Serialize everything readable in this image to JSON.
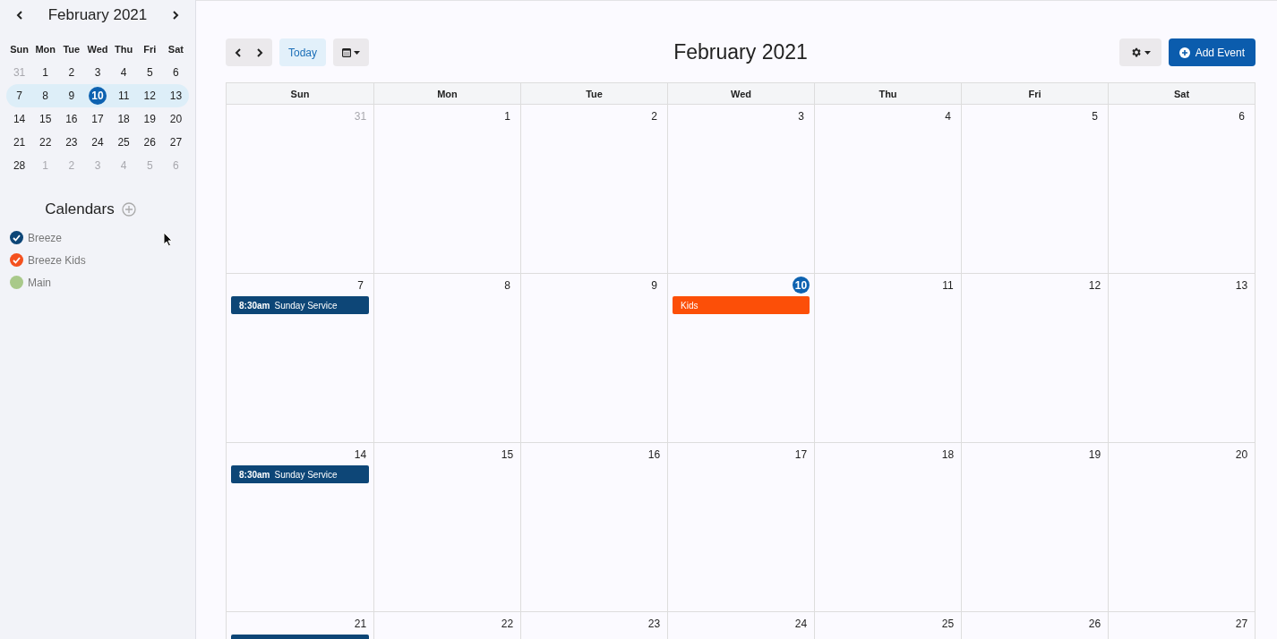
{
  "mini_calendar": {
    "title": "February 2021",
    "weekdays": [
      "Sun",
      "Mon",
      "Tue",
      "Wed",
      "Thu",
      "Fri",
      "Sat"
    ],
    "weeks": [
      {
        "selected": false,
        "days": [
          {
            "label": "31",
            "muted": true,
            "selected": false
          },
          {
            "label": "1",
            "muted": false,
            "selected": false
          },
          {
            "label": "2",
            "muted": false,
            "selected": false
          },
          {
            "label": "3",
            "muted": false,
            "selected": false
          },
          {
            "label": "4",
            "muted": false,
            "selected": false
          },
          {
            "label": "5",
            "muted": false,
            "selected": false
          },
          {
            "label": "6",
            "muted": false,
            "selected": false
          }
        ]
      },
      {
        "selected": true,
        "days": [
          {
            "label": "7",
            "muted": false,
            "selected": false
          },
          {
            "label": "8",
            "muted": false,
            "selected": false
          },
          {
            "label": "9",
            "muted": false,
            "selected": false
          },
          {
            "label": "10",
            "muted": false,
            "selected": true
          },
          {
            "label": "11",
            "muted": false,
            "selected": false
          },
          {
            "label": "12",
            "muted": false,
            "selected": false
          },
          {
            "label": "13",
            "muted": false,
            "selected": false
          }
        ]
      },
      {
        "selected": false,
        "days": [
          {
            "label": "14",
            "muted": false,
            "selected": false
          },
          {
            "label": "15",
            "muted": false,
            "selected": false
          },
          {
            "label": "16",
            "muted": false,
            "selected": false
          },
          {
            "label": "17",
            "muted": false,
            "selected": false
          },
          {
            "label": "18",
            "muted": false,
            "selected": false
          },
          {
            "label": "19",
            "muted": false,
            "selected": false
          },
          {
            "label": "20",
            "muted": false,
            "selected": false
          }
        ]
      },
      {
        "selected": false,
        "days": [
          {
            "label": "21",
            "muted": false,
            "selected": false
          },
          {
            "label": "22",
            "muted": false,
            "selected": false
          },
          {
            "label": "23",
            "muted": false,
            "selected": false
          },
          {
            "label": "24",
            "muted": false,
            "selected": false
          },
          {
            "label": "25",
            "muted": false,
            "selected": false
          },
          {
            "label": "26",
            "muted": false,
            "selected": false
          },
          {
            "label": "27",
            "muted": false,
            "selected": false
          }
        ]
      },
      {
        "selected": false,
        "days": [
          {
            "label": "28",
            "muted": false,
            "selected": false
          },
          {
            "label": "1",
            "muted": true,
            "selected": false
          },
          {
            "label": "2",
            "muted": true,
            "selected": false
          },
          {
            "label": "3",
            "muted": true,
            "selected": false
          },
          {
            "label": "4",
            "muted": true,
            "selected": false
          },
          {
            "label": "5",
            "muted": true,
            "selected": false
          },
          {
            "label": "6",
            "muted": true,
            "selected": false
          }
        ]
      }
    ]
  },
  "calendars": {
    "title": "Calendars",
    "items": [
      {
        "label": "Breeze",
        "checked": true,
        "color": "#0d4677"
      },
      {
        "label": "Breeze Kids",
        "checked": true,
        "color": "#f4511e"
      },
      {
        "label": "Main",
        "checked": false,
        "color": "#a9c98a"
      }
    ]
  },
  "toolbar": {
    "today": "Today",
    "title": "February 2021",
    "add_event": "Add Event"
  },
  "month": {
    "weekdays": [
      "Sun",
      "Mon",
      "Tue",
      "Wed",
      "Thu",
      "Fri",
      "Sat"
    ],
    "weeks": [
      {
        "days": [
          {
            "label": "31",
            "muted": true,
            "today": false
          },
          {
            "label": "1",
            "muted": false,
            "today": false
          },
          {
            "label": "2",
            "muted": false,
            "today": false
          },
          {
            "label": "3",
            "muted": false,
            "today": false
          },
          {
            "label": "4",
            "muted": false,
            "today": false
          },
          {
            "label": "5",
            "muted": false,
            "today": false
          },
          {
            "label": "6",
            "muted": false,
            "today": false
          }
        ]
      },
      {
        "days": [
          {
            "label": "7",
            "muted": false,
            "today": false,
            "events": [
              {
                "time": "8:30am",
                "title": "Sunday Service",
                "color": "#0d4677"
              }
            ]
          },
          {
            "label": "8",
            "muted": false,
            "today": false
          },
          {
            "label": "9",
            "muted": false,
            "today": false
          },
          {
            "label": "10",
            "muted": false,
            "today": true,
            "events": [
              {
                "title": "Kids",
                "color": "#fc4f08"
              }
            ]
          },
          {
            "label": "11",
            "muted": false,
            "today": false
          },
          {
            "label": "12",
            "muted": false,
            "today": false
          },
          {
            "label": "13",
            "muted": false,
            "today": false
          }
        ]
      },
      {
        "days": [
          {
            "label": "14",
            "muted": false,
            "today": false,
            "events": [
              {
                "time": "8:30am",
                "title": "Sunday Service",
                "color": "#0d4677"
              }
            ]
          },
          {
            "label": "15",
            "muted": false,
            "today": false
          },
          {
            "label": "16",
            "muted": false,
            "today": false
          },
          {
            "label": "17",
            "muted": false,
            "today": false
          },
          {
            "label": "18",
            "muted": false,
            "today": false
          },
          {
            "label": "19",
            "muted": false,
            "today": false
          },
          {
            "label": "20",
            "muted": false,
            "today": false
          }
        ]
      },
      {
        "days": [
          {
            "label": "21",
            "muted": false,
            "today": false,
            "events": [
              {
                "color": "#0d4677"
              }
            ]
          },
          {
            "label": "22",
            "muted": false,
            "today": false
          },
          {
            "label": "23",
            "muted": false,
            "today": false
          },
          {
            "label": "24",
            "muted": false,
            "today": false
          },
          {
            "label": "25",
            "muted": false,
            "today": false
          },
          {
            "label": "26",
            "muted": false,
            "today": false
          },
          {
            "label": "27",
            "muted": false,
            "today": false
          }
        ]
      }
    ]
  }
}
